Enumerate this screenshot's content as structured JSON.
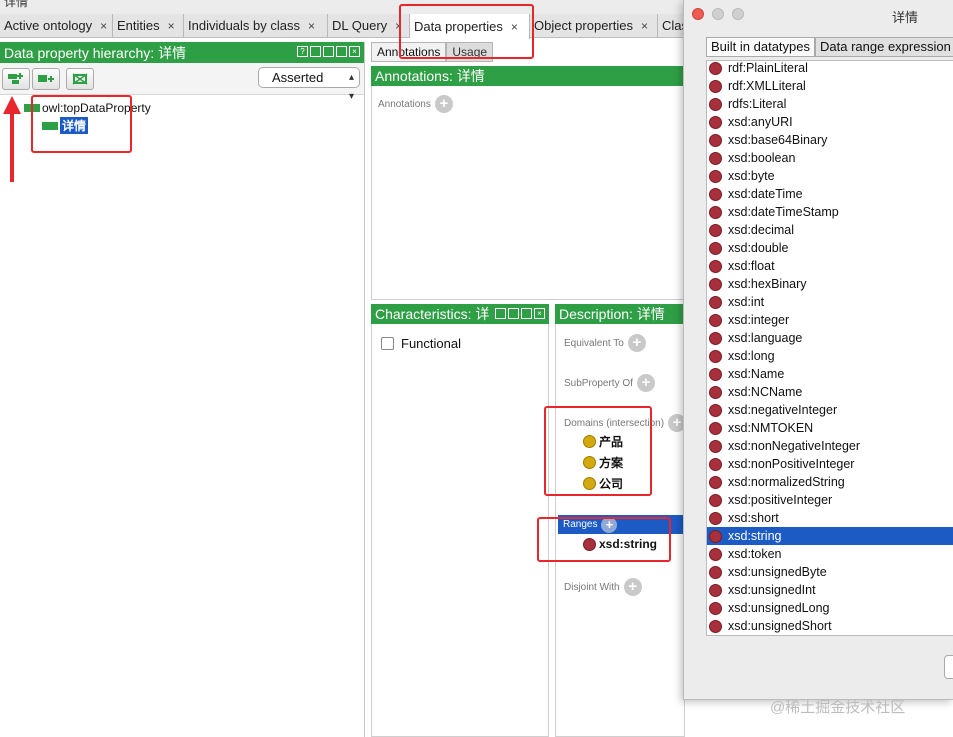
{
  "window": {
    "title": "详情"
  },
  "tabs": [
    {
      "label": "Active ontology"
    },
    {
      "label": "Entities"
    },
    {
      "label": "Individuals by class"
    },
    {
      "label": "DL Query"
    },
    {
      "label": "Data properties",
      "active": true
    },
    {
      "label": "Object properties"
    },
    {
      "label": "Clas"
    }
  ],
  "tab_close_glyph": "×",
  "left": {
    "header": "Data property hierarchy: 详情",
    "view_mode": "Asserted",
    "tree_root": "owl:topDataProperty",
    "tree_child": "详情"
  },
  "annotations": {
    "tabs": [
      "Annotations",
      "Usage"
    ],
    "header": "Annotations: 详情",
    "label": "Annotations"
  },
  "characteristics": {
    "header": "Characteristics: 详",
    "functional_label": "Functional"
  },
  "description": {
    "header": "Description: 详情",
    "equivalent_to": "Equivalent To",
    "subproperty_of": "SubProperty Of",
    "domains_label": "Domains (intersection)",
    "domains": [
      "产品",
      "方案",
      "公司"
    ],
    "ranges_label": "Ranges",
    "ranges": [
      "xsd:string"
    ],
    "disjoint_with": "Disjoint With"
  },
  "dialog": {
    "title": "详情",
    "tabs": [
      "Built in datatypes",
      "Data range expression"
    ],
    "datatypes": [
      "rdf:PlainLiteral",
      "rdf:XMLLiteral",
      "rdfs:Literal",
      "xsd:anyURI",
      "xsd:base64Binary",
      "xsd:boolean",
      "xsd:byte",
      "xsd:dateTime",
      "xsd:dateTimeStamp",
      "xsd:decimal",
      "xsd:double",
      "xsd:float",
      "xsd:hexBinary",
      "xsd:int",
      "xsd:integer",
      "xsd:language",
      "xsd:long",
      "xsd:Name",
      "xsd:NCName",
      "xsd:negativeInteger",
      "xsd:NMTOKEN",
      "xsd:nonNegativeInteger",
      "xsd:nonPositiveInteger",
      "xsd:normalizedString",
      "xsd:positiveInteger",
      "xsd:short",
      "xsd:string",
      "xsd:token",
      "xsd:unsignedByte",
      "xsd:unsignedInt",
      "xsd:unsignedLong",
      "xsd:unsignedShort"
    ],
    "selected_datatype": "xsd:string"
  },
  "watermark": "@稀土掘金技术社区",
  "colors": {
    "header_green": "#2f9f46",
    "selection_blue": "#1c5bc4",
    "annotation_red": "#e8272d",
    "datatype_dot": "#a8303d",
    "class_dot": "#d4a90f"
  }
}
